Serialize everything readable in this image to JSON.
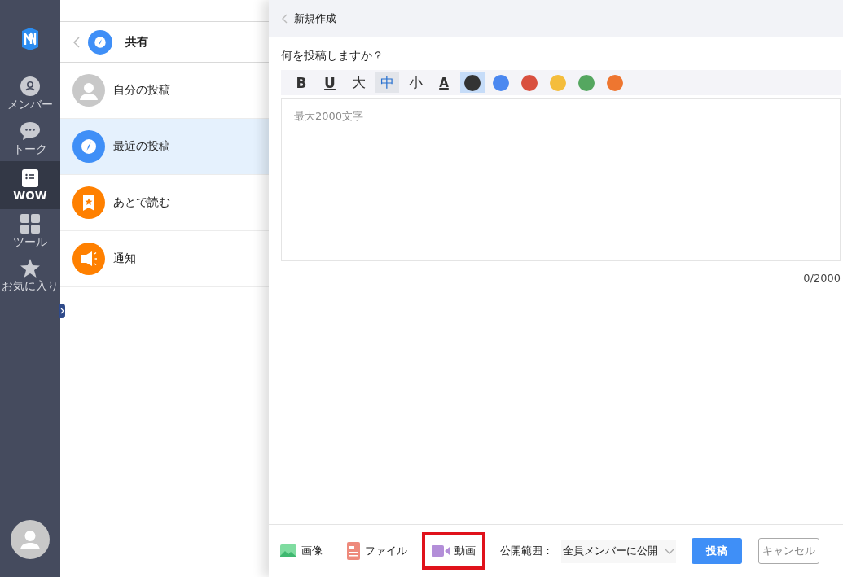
{
  "rail": {
    "items": [
      {
        "kind": "member",
        "label": "メンバー",
        "selected": false
      },
      {
        "kind": "talk",
        "label": "トーク",
        "selected": false
      },
      {
        "kind": "wow",
        "label": "WOW",
        "selected": true
      },
      {
        "kind": "tools",
        "label": "ツール",
        "selected": false
      },
      {
        "kind": "favorite",
        "label": "お気に入り",
        "selected": false
      }
    ]
  },
  "feed_menu": {
    "title": "共有",
    "items": [
      {
        "kind": "person",
        "label": "自分の投稿",
        "color": "#c8c8c8",
        "selected": false
      },
      {
        "kind": "compass",
        "label": "最近の投稿",
        "color": "#3f8ff7",
        "selected": true
      },
      {
        "kind": "bookmark",
        "label": "あとで読む",
        "color": "#ff8000",
        "selected": false
      },
      {
        "kind": "megaphone",
        "label": "通知",
        "color": "#ff8000",
        "selected": false
      }
    ]
  },
  "composer": {
    "title": "新規作成",
    "prompt": "何を投稿しますか？",
    "format_buttons": [
      {
        "kind": "bold",
        "label": "B",
        "selected": false
      },
      {
        "kind": "underline",
        "label": "U",
        "selected": false
      },
      {
        "kind": "size",
        "label": "大",
        "selected": false
      },
      {
        "kind": "size",
        "label": "中",
        "selected": true
      },
      {
        "kind": "size",
        "label": "小",
        "selected": false
      },
      {
        "kind": "color",
        "label": "A",
        "selected": false
      }
    ],
    "color_swatches": [
      {
        "color": "#333333",
        "selected": true
      },
      {
        "color": "#4b88f0",
        "selected": false
      },
      {
        "color": "#d9503f",
        "selected": false
      },
      {
        "color": "#f4bd3c",
        "selected": false
      },
      {
        "color": "#55a760",
        "selected": false
      },
      {
        "color": "#ee7630",
        "selected": false
      }
    ],
    "body": {
      "placeholder": "最大2000文字"
    },
    "counter": "0/2000",
    "attachments": [
      {
        "kind": "image",
        "label": "画像",
        "highlighted": false
      },
      {
        "kind": "file",
        "label": "ファイル",
        "highlighted": false
      },
      {
        "kind": "video",
        "label": "動画",
        "highlighted": true
      }
    ],
    "visibility": {
      "label": "公開範囲：",
      "value": "全員メンバーに公開"
    },
    "buttons": [
      {
        "kind": "primary",
        "label": "投稿"
      },
      {
        "kind": "secondary",
        "label": "キャンセル"
      }
    ]
  }
}
